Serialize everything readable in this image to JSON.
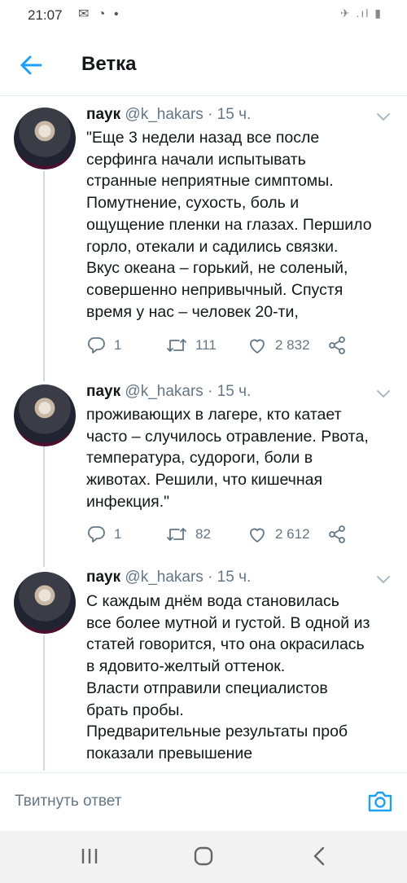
{
  "status_bar": {
    "time": "21:07",
    "icons": "✉ ◔ •",
    "right_icons": "✈ .ıl ▮"
  },
  "app_bar": {
    "title": "Ветка"
  },
  "tweets": [
    {
      "name": "паук",
      "handle": "@k_hakars",
      "time": "· 15 ч.",
      "text": "\"Еще 3 недели назад все после\nсерфинга начали испытывать\nстранные неприятные симптомы.\nПомутнение, сухость, боль и\nощущение пленки на глазах. Першило\nгорло, отекали и садились связки.\nВкус океана – горький, не соленый,\nсовершенно непривычный. Спустя\nвремя у нас – человек 20-ти,",
      "replies": "1",
      "retweets": "111",
      "likes": "2 832"
    },
    {
      "name": "паук",
      "handle": "@k_hakars",
      "time": "· 15 ч.",
      "text": "проживающих в лагере, кто катает\nчасто – случилось отравление. Рвота,\nтемпература, судороги, боли в\nживотах. Решили, что кишечная\nинфекция.\"",
      "replies": "1",
      "retweets": "82",
      "likes": "2 612"
    },
    {
      "name": "паук",
      "handle": "@k_hakars",
      "time": "· 15 ч.",
      "text": "С каждым днём вода становилась\nвсе более мутной и густой. В одной из\nстатей говорится, что она окрасилась\nв ядовито-желтый оттенок.\nВласти отправили специалистов\nбрать пробы.\nПредварительные результаты проб\nпоказали превышение"
    }
  ],
  "reply_bar": {
    "placeholder": "Твитнуть ответ"
  },
  "icons": {
    "back": "arrow-left-icon",
    "chevron": "chevron-down-icon",
    "reply": "reply-icon",
    "retweet": "retweet-icon",
    "like": "heart-icon",
    "share": "share-icon",
    "camera": "camera-icon",
    "nav_recent": "recent-apps-icon",
    "nav_home": "home-icon",
    "nav_back": "back-icon"
  },
  "colors": {
    "accent": "#1da1f2",
    "secondary_text": "#657786",
    "divider": "#e6ecf0"
  }
}
